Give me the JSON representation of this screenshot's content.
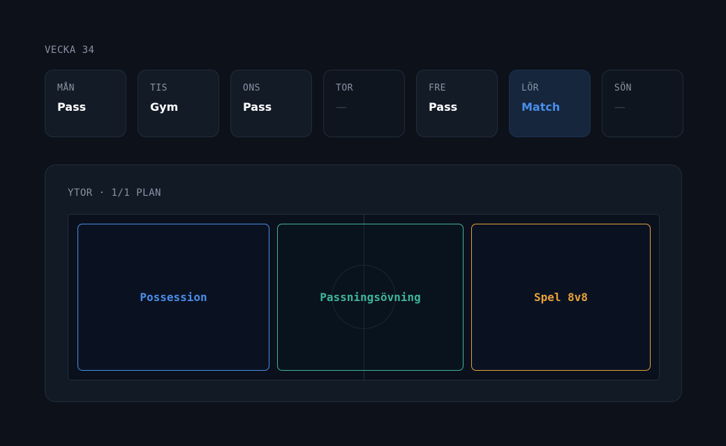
{
  "week": {
    "label": "VECKA 34"
  },
  "days": [
    {
      "name": "MÅN",
      "activity": "Pass"
    },
    {
      "name": "TIS",
      "activity": "Gym"
    },
    {
      "name": "ONS",
      "activity": "Pass"
    },
    {
      "name": "TOR",
      "activity": "—"
    },
    {
      "name": "FRE",
      "activity": "Pass"
    },
    {
      "name": "LÖR",
      "activity": "Match"
    },
    {
      "name": "SÖN",
      "activity": "—"
    }
  ],
  "areas": {
    "title": "YTOR · 1/1 PLAN",
    "zones": [
      {
        "label": "Possession",
        "color": "#4a8ee8"
      },
      {
        "label": "Passningsövning",
        "color": "#3fb59a"
      },
      {
        "label": "Spel 8v8",
        "color": "#e8a23a"
      }
    ]
  },
  "colors": {
    "background": "#0c111a",
    "accent": "#4a8ee8"
  }
}
